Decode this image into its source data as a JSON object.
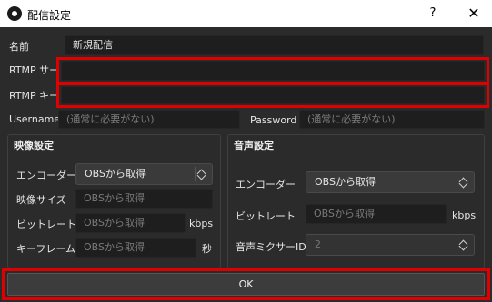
{
  "window": {
    "title": "配信設定",
    "help_label": "?",
    "close_label": "✕"
  },
  "form": {
    "name_label": "名前",
    "name_value": "新規配信",
    "rtmp_server_label": "RTMP サーバー",
    "rtmp_server_value": "",
    "rtmp_key_label": "RTMP キー",
    "rtmp_key_value": "",
    "username_label": "Username",
    "username_placeholder": "(通常に必要がない)",
    "password_label": "Password",
    "password_placeholder": "(通常に必要がない)"
  },
  "video": {
    "title": "映像設定",
    "encoder_label": "エンコーダー",
    "encoder_value": "OBSから取得",
    "size_label": "映像サイズ",
    "size_placeholder": "OBSから取得",
    "bitrate_label": "ビットレート",
    "bitrate_placeholder": "OBSから取得",
    "bitrate_unit": "kbps",
    "keyframe_label": "キーフレーム",
    "keyframe_placeholder": "OBSから取得",
    "keyframe_unit": "秒"
  },
  "audio": {
    "title": "音声設定",
    "encoder_label": "エンコーダー",
    "encoder_value": "OBSから取得",
    "bitrate_label": "ビットレート",
    "bitrate_placeholder": "OBSから取得",
    "bitrate_unit": "kbps",
    "mixer_label": "音声ミクサーID",
    "mixer_value": "2"
  },
  "footer": {
    "ok_label": "OK"
  },
  "colors": {
    "highlight": "#e00000",
    "background": "#2b2b2b"
  }
}
